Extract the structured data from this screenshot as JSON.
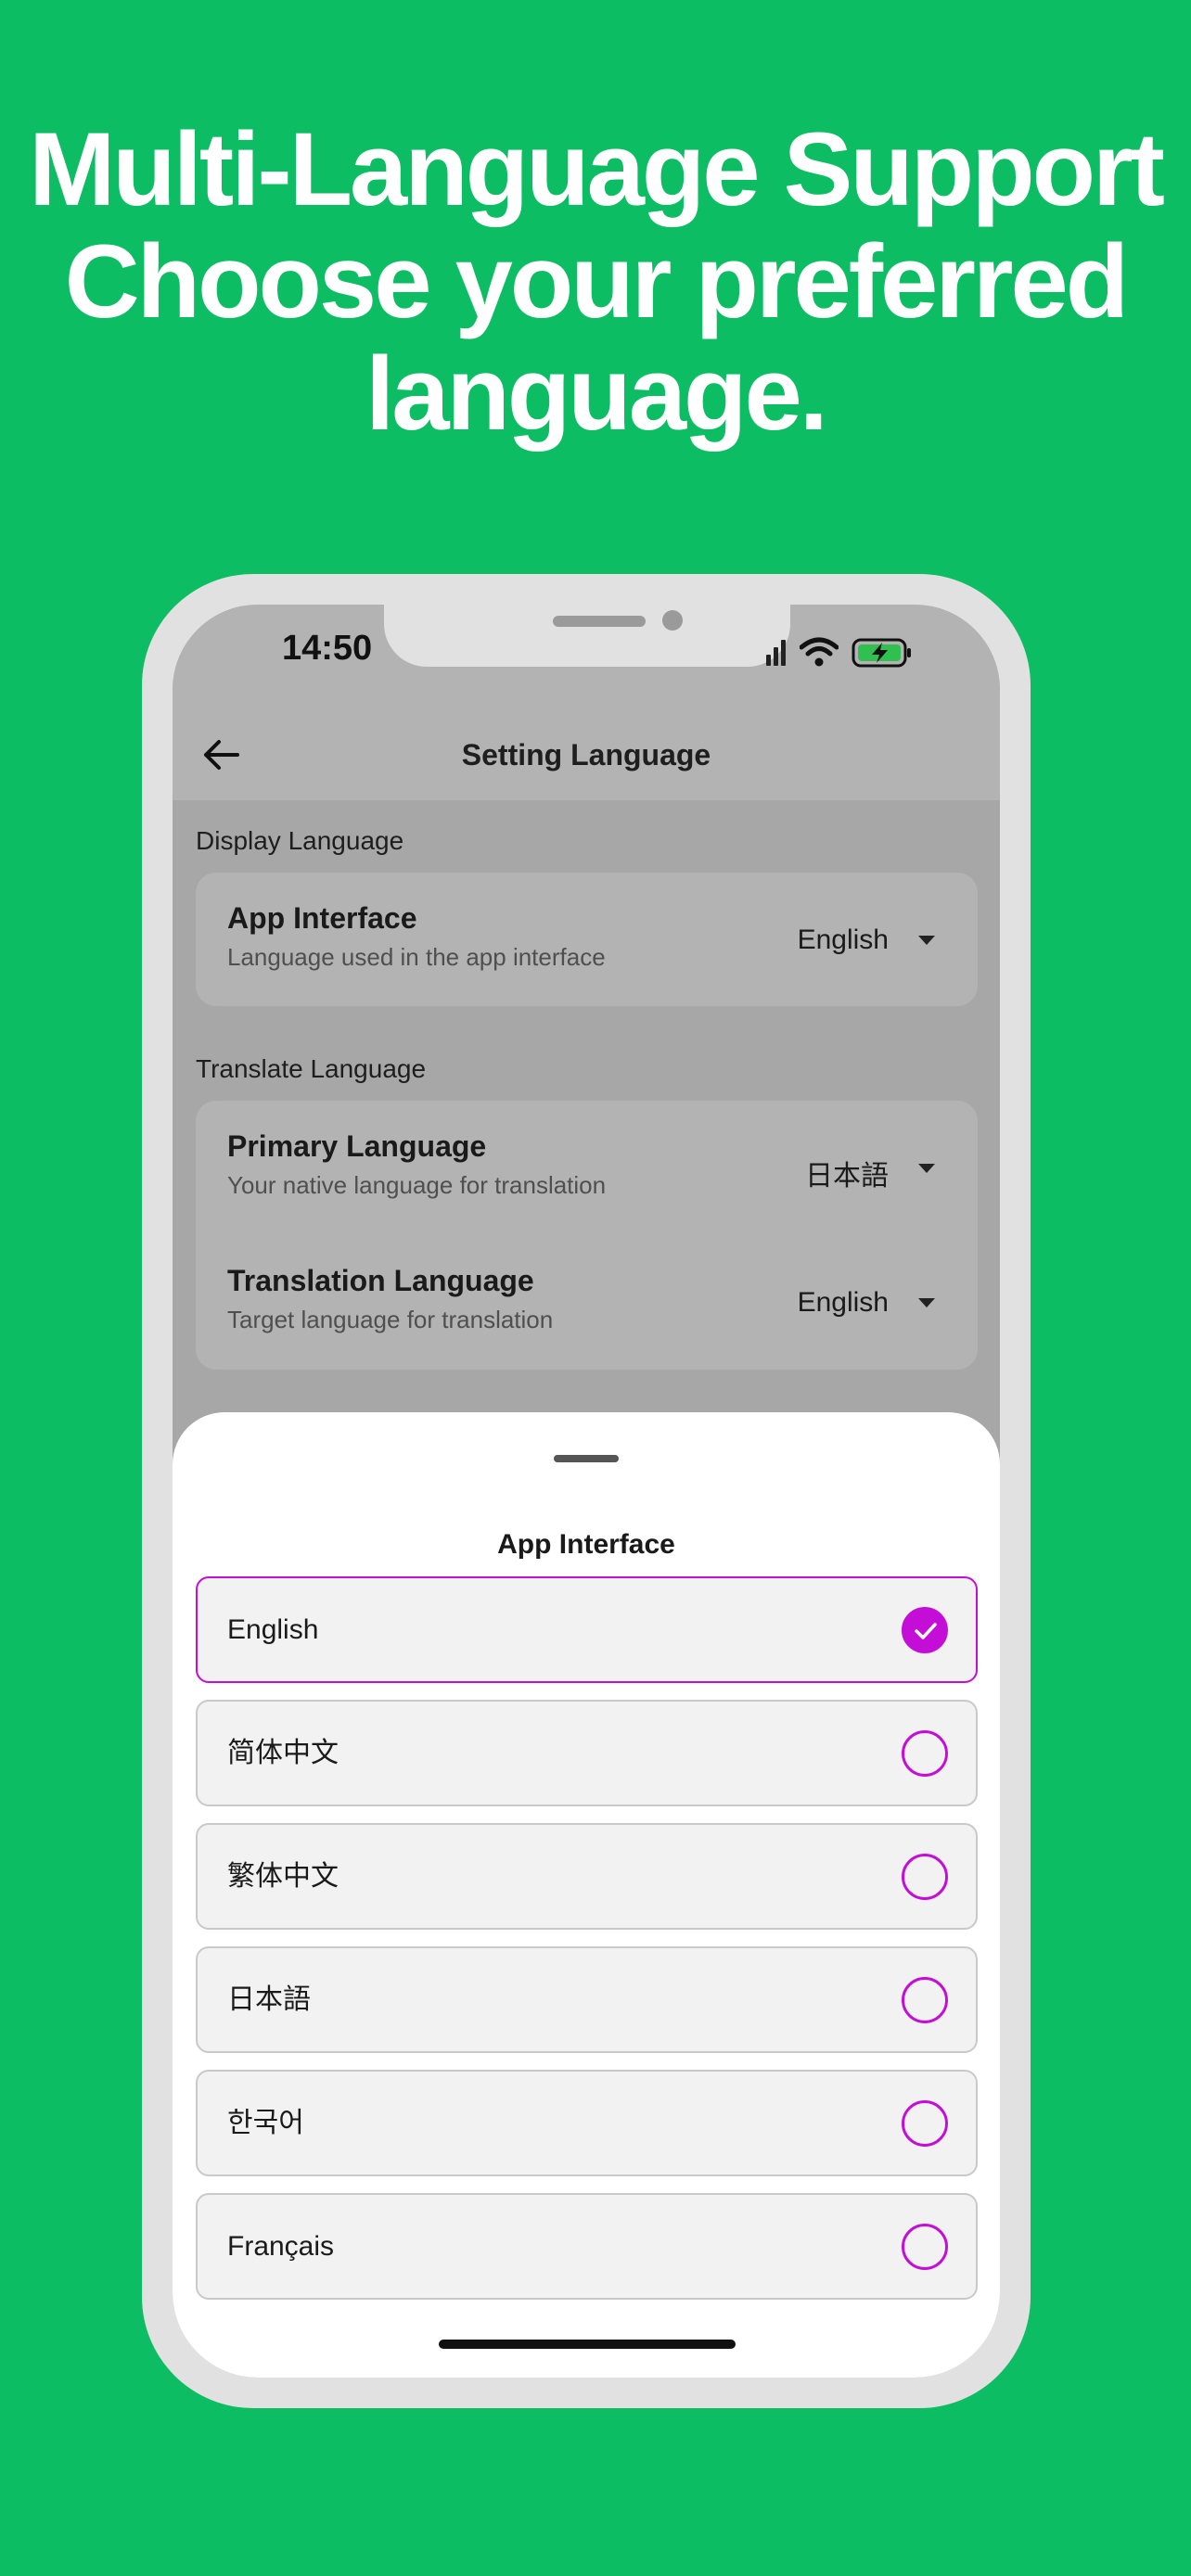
{
  "headline": {
    "line1": "Multi-Language Support",
    "line2": "Choose your preferred",
    "line3": "language."
  },
  "status_bar": {
    "time": "14:50",
    "icons": [
      "cellular-icon",
      "wifi-icon",
      "battery-charging-icon"
    ]
  },
  "nav": {
    "back_icon": "arrow-left-icon",
    "title": "Setting Language"
  },
  "display_section": {
    "label": "Display Language",
    "rows": [
      {
        "title": "App Interface",
        "subtitle": "Language used in the app interface",
        "value": "English"
      }
    ]
  },
  "translate_section": {
    "label": "Translate Language",
    "rows": [
      {
        "title": "Primary Language",
        "subtitle": "Your native language for translation",
        "value": "日本語"
      },
      {
        "title": "Translation Language",
        "subtitle": "Target language for translation",
        "value": "English"
      }
    ]
  },
  "sheet": {
    "title": "App Interface",
    "options": [
      {
        "label": "English",
        "selected": true
      },
      {
        "label": "简体中文",
        "selected": false
      },
      {
        "label": "繁体中文",
        "selected": false
      },
      {
        "label": "日本語",
        "selected": false
      },
      {
        "label": "한국어",
        "selected": false
      },
      {
        "label": "Français",
        "selected": false
      }
    ]
  },
  "colors": {
    "background": "#0cbd63",
    "accent": "#c40ed8",
    "dim_overlay": "#a7a7a7"
  }
}
